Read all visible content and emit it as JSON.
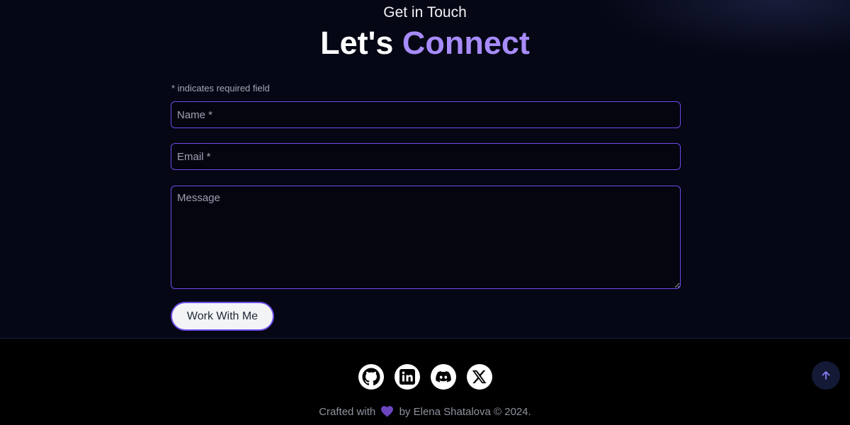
{
  "contact": {
    "eyebrow": "Get in Touch",
    "title_main": "Let's",
    "title_accent": "Connect",
    "required_note": "* indicates required field",
    "name_placeholder": "Name *",
    "email_placeholder": "Email *",
    "message_placeholder": "Message",
    "submit_label": "Work With Me"
  },
  "footer": {
    "social_icons": [
      "github-icon",
      "linkedin-icon",
      "discord-icon",
      "x-icon"
    ],
    "credit_prefix": "Crafted with",
    "credit_suffix": "by Elena Shatalova © 2024."
  },
  "colors": {
    "background": "#050714",
    "accent": "#a78bfa",
    "field_border": "#6d4ae8",
    "footer_background": "#000000",
    "heart": "#6b46c1"
  }
}
